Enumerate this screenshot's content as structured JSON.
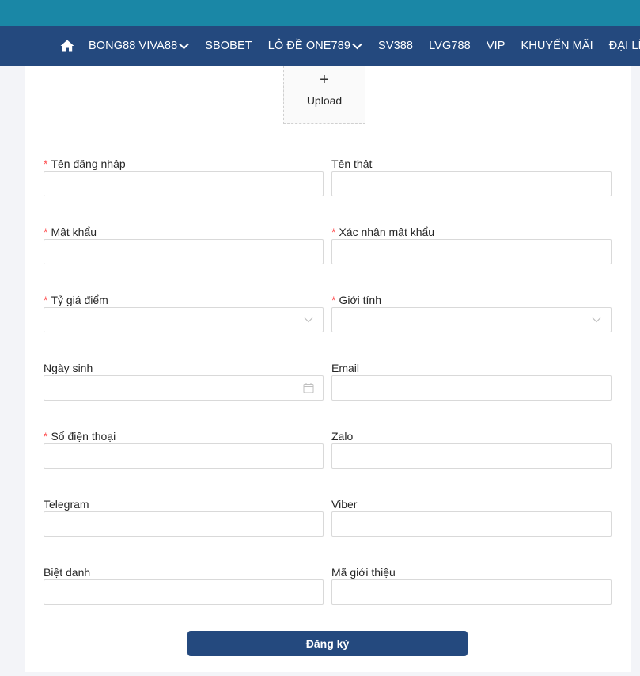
{
  "nav": {
    "items": [
      {
        "label": "BONG88 VIVA88",
        "dropdown": true
      },
      {
        "label": "SBOBET",
        "dropdown": false
      },
      {
        "label": "LÔ ĐỀ ONE789",
        "dropdown": true
      },
      {
        "label": "SV388",
        "dropdown": false
      },
      {
        "label": "LVG788",
        "dropdown": false
      },
      {
        "label": "VIP",
        "dropdown": false
      },
      {
        "label": "KHUYẾN MÃI",
        "dropdown": false
      },
      {
        "label": "ĐẠI LÍ",
        "dropdown": false
      }
    ]
  },
  "upload": {
    "label": "Upload"
  },
  "form": {
    "username": {
      "label": "Tên đăng nhập",
      "value": ""
    },
    "realname": {
      "label": "Tên thật",
      "value": ""
    },
    "password": {
      "label": "Mật khẩu",
      "value": ""
    },
    "confirm_password": {
      "label": "Xác nhận mật khẩu",
      "value": ""
    },
    "rate": {
      "label": "Tỷ giá điểm",
      "value": ""
    },
    "gender": {
      "label": "Giới tính",
      "value": ""
    },
    "birthday": {
      "label": "Ngày sinh",
      "value": ""
    },
    "email": {
      "label": "Email",
      "value": ""
    },
    "phone": {
      "label": "Số điện thoại",
      "value": ""
    },
    "zalo": {
      "label": "Zalo",
      "value": ""
    },
    "telegram": {
      "label": "Telegram",
      "value": ""
    },
    "viber": {
      "label": "Viber",
      "value": ""
    },
    "nickname": {
      "label": "Biệt danh",
      "value": ""
    },
    "referral": {
      "label": "Mã giới thiệu",
      "value": ""
    },
    "submit_label": "Đăng ký",
    "required_marker": "*"
  },
  "colors": {
    "topbar": "#1a87a6",
    "navbar": "#24497e",
    "required": "#ff4d4f",
    "button": "#24497e"
  },
  "icons": {
    "home": "home-icon",
    "dropdown": "chevron-down-icon",
    "select": "chevron-down-icon",
    "calendar": "calendar-icon",
    "upload": "plus-icon"
  }
}
